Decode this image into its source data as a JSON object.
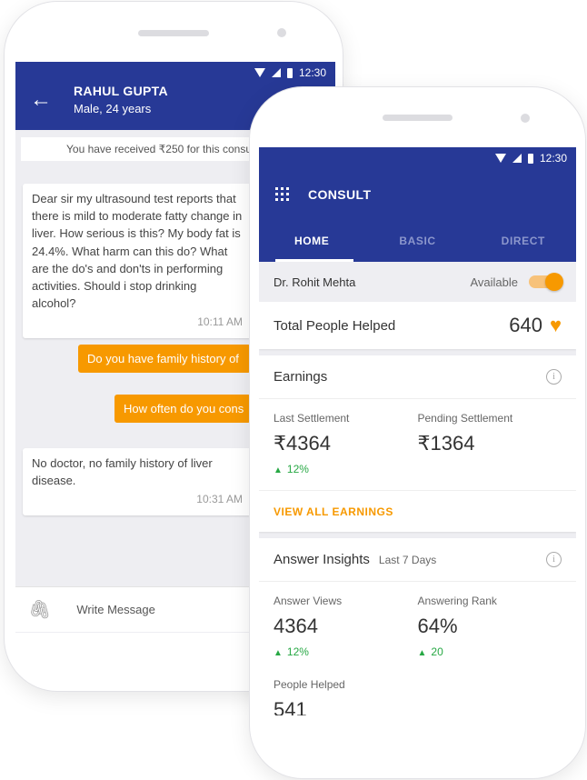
{
  "chat": {
    "status_time": "12:30",
    "patient_name": "RAHUL GUPTA",
    "patient_info": "Male, 24 years",
    "notice": "You have received ₹250 for this consu",
    "messages": {
      "q1": "Dear sir my ultrasound test reports that there is mild to moderate fatty change in liver. How serious is this? My body fat is 24.4%. What harm can this do? What are the do's and don'ts in performing activities. Should i stop drinking alcohol?",
      "q1_time": "10:11 AM",
      "r1": "Do you have family history of",
      "r2": "How often do you cons",
      "q2": "No doctor, no family history of liver disease.",
      "q2_time": "10:31 AM"
    },
    "compose_placeholder": "Write Message"
  },
  "app": {
    "status_time": "12:30",
    "title": "CONSULT",
    "tabs": [
      "HOME",
      "BASIC",
      "DIRECT"
    ],
    "doctor": "Dr. Rohit Mehta",
    "availability": "Available",
    "available_on": true,
    "helped_label": "Total People Helped",
    "helped_count": "640",
    "earnings": {
      "title": "Earnings",
      "last_label": "Last Settlement",
      "last_value": "₹4364",
      "last_delta": "12%",
      "pending_label": "Pending Settlement",
      "pending_value": "₹1364",
      "view_all": "VIEW ALL EARNINGS"
    },
    "insights": {
      "title": "Answer Insights",
      "period": "Last 7 Days",
      "views_label": "Answer Views",
      "views_value": "4364",
      "views_delta": "12%",
      "rank_label": "Answering Rank",
      "rank_value": "64%",
      "rank_delta": "20",
      "people_label": "People Helped",
      "people_value": "541"
    }
  }
}
